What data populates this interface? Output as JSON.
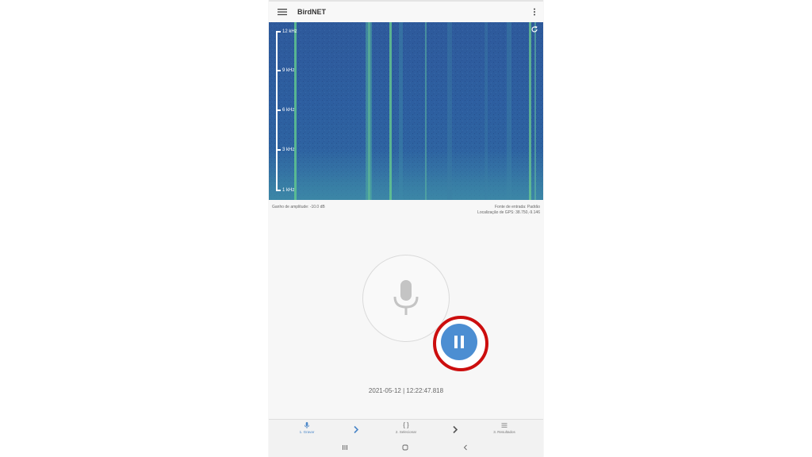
{
  "app": {
    "title": "BirdNET"
  },
  "spectrogram": {
    "ticks": [
      "12 kHz",
      "9 kHz",
      "6 kHz",
      "3 kHz",
      "1 kHz"
    ],
    "colors": {
      "base": "#2e5a9c",
      "streak": "#5fc58f"
    }
  },
  "info": {
    "amplitude_gain": "Ganho de amplitude: -10.0 dB",
    "input_source": "Fonte de entrada: Padrão",
    "gps_location": "Localização de GPS: 38.750,-9.146"
  },
  "recording": {
    "timestamp": "2021-05-12 | 12:22:47.818"
  },
  "bottom_nav": {
    "step1": "1. Gravar",
    "step2": "2. Selecionar",
    "step3": "3. Resultados"
  },
  "colors": {
    "accent": "#4c8ed2",
    "highlight": "#cc0e0e"
  },
  "icons": [
    "menu-icon",
    "more-vert-icon",
    "refresh-icon",
    "microphone-icon",
    "pause-icon",
    "braces-icon",
    "list-icon",
    "chevron-right-icon"
  ]
}
